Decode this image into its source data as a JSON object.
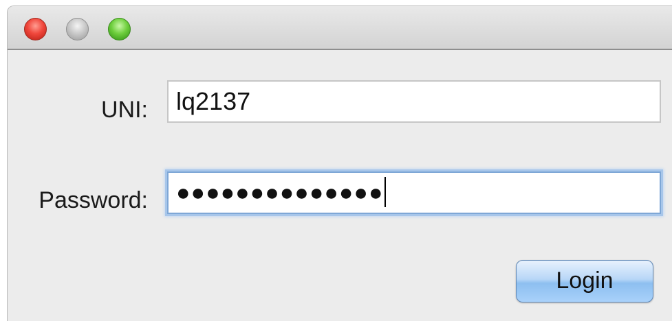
{
  "window": {
    "controls": {
      "close_color": "#f0473c",
      "minimize_color": "#c5c5c5",
      "zoom_color": "#6fcf3e"
    }
  },
  "form": {
    "uni_label": "UNI:",
    "uni_value": "lq2137",
    "password_label": "Password:",
    "password_value": "●●●●●●●●●●●●●●",
    "login_label": "Login"
  },
  "colors": {
    "focus_ring": "#7ea7d6",
    "button_accent": "#8dbff0"
  }
}
